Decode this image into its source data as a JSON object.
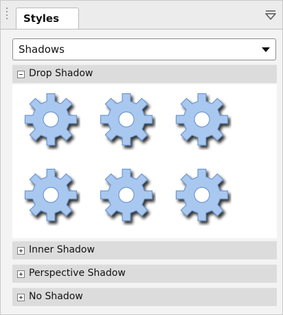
{
  "panel": {
    "tab_label": "Styles",
    "menu_icon": "panel-menu-icon"
  },
  "dropdown": {
    "selected": "Shadows"
  },
  "sections": [
    {
      "label": "Drop Shadow",
      "expanded": true
    },
    {
      "label": "Inner Shadow",
      "expanded": false
    },
    {
      "label": "Perspective Shadow",
      "expanded": false
    },
    {
      "label": "No Shadow",
      "expanded": false
    }
  ],
  "gallery": {
    "item_icon": "gear-icon",
    "item_count": 6,
    "colors": {
      "fill": "#a9c8f0",
      "stroke": "#6e97cf",
      "shadow": "#6f6f6f"
    }
  }
}
